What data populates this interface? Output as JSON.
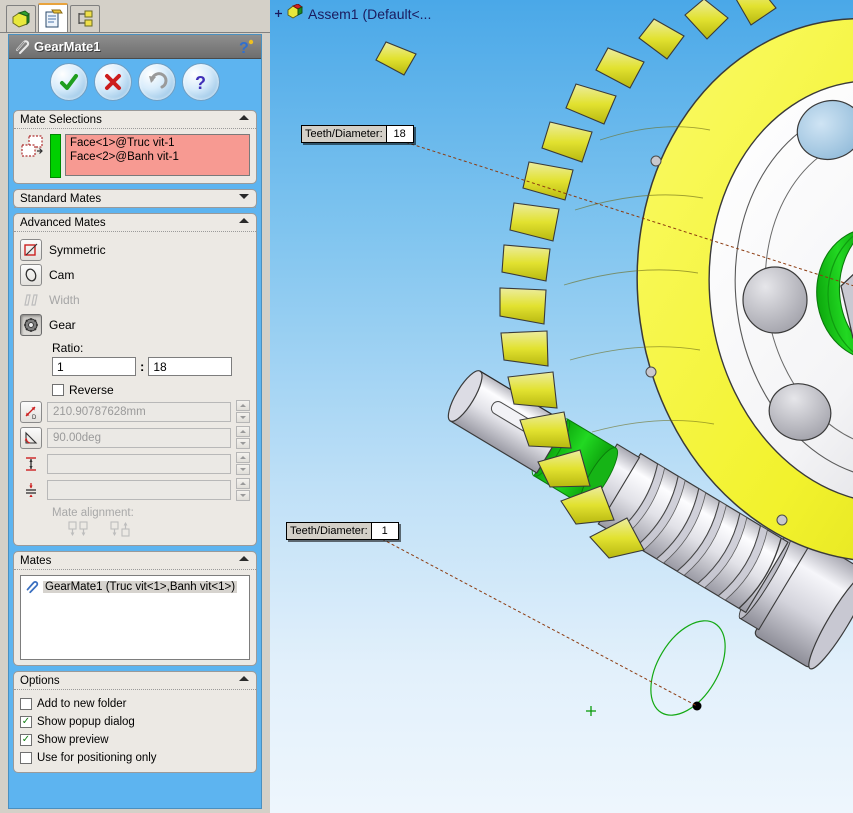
{
  "tabstrip": {
    "tabs": [
      {
        "name": "feature-manager-tab",
        "icon": "feature-tree-icon",
        "active": false
      },
      {
        "name": "property-manager-tab",
        "icon": "property-manager-icon",
        "active": true
      },
      {
        "name": "configuration-manager-tab",
        "icon": "configuration-manager-icon",
        "active": false
      }
    ]
  },
  "property_manager": {
    "title": "GearMate1",
    "title_icon": "mate-paperclip-icon",
    "help_icon": "help-question-icon",
    "actions": [
      {
        "label": "OK",
        "icon": "green-check-icon",
        "enabled": true
      },
      {
        "label": "Cancel",
        "icon": "red-x-icon",
        "enabled": true
      },
      {
        "label": "Undo",
        "icon": "undo-arrow-icon",
        "enabled": false
      },
      {
        "label": "Help",
        "icon": "blue-question-icon",
        "enabled": true
      }
    ]
  },
  "mate_selections": {
    "header": "Mate Selections",
    "expanded": true,
    "selection_icon": "entities-to-mate-icon",
    "entities": "Face<1>@Truc vit-1\nFace<2>@Banh vit-1",
    "entity_list": [
      "Face<1>@Truc vit-1",
      "Face<2>@Banh vit-1"
    ]
  },
  "standard_mates": {
    "header": "Standard Mates",
    "expanded": false
  },
  "advanced_mates": {
    "header": "Advanced Mates",
    "expanded": true,
    "items": [
      {
        "label": "Symmetric",
        "icon": "symmetric-mate-icon",
        "enabled": true,
        "selected": false
      },
      {
        "label": "Cam",
        "icon": "cam-mate-icon",
        "enabled": true,
        "selected": false
      },
      {
        "label": "Width",
        "icon": "width-mate-icon",
        "enabled": false,
        "selected": false
      },
      {
        "label": "Gear",
        "icon": "gear-mate-icon",
        "enabled": true,
        "selected": true
      }
    ],
    "ratio_label": "Ratio:",
    "ratio_first": "1",
    "ratio_separator": ":",
    "ratio_second": "18",
    "reverse_label": "Reverse",
    "reverse_checked": false,
    "fields": [
      {
        "icon": "distance-dimension-icon",
        "value": "210.90787628mm",
        "enabled": false
      },
      {
        "icon": "angle-dimension-icon",
        "value": "90.00deg",
        "enabled": false
      },
      {
        "icon": "max-distance-icon",
        "value": "",
        "enabled": false
      },
      {
        "icon": "min-distance-icon",
        "value": "",
        "enabled": false
      }
    ],
    "mate_alignment_label": "Mate alignment:",
    "alignment_options": [
      {
        "name": "aligned-icon",
        "enabled": false
      },
      {
        "name": "anti-aligned-icon",
        "enabled": false
      }
    ]
  },
  "mates": {
    "header": "Mates",
    "expanded": true,
    "items": [
      {
        "icon": "mate-paperclip-icon",
        "label": "GearMate1 (Truc vit<1>,Banh vit<1>)"
      }
    ]
  },
  "options": {
    "header": "Options",
    "expanded": true,
    "items": [
      {
        "label": "Add to new folder",
        "checked": false
      },
      {
        "label": "Show popup dialog",
        "checked": true
      },
      {
        "label": "Show preview",
        "checked": true
      },
      {
        "label": "Use for positioning only",
        "checked": false
      }
    ]
  },
  "viewport": {
    "assembly_title": "Assem1  (Default<...",
    "assembly_icon": "assembly-icon",
    "expand_icon": "plus-icon",
    "callouts": [
      {
        "label": "Teeth/Diameter:",
        "value": "18",
        "target": "worm-gear-wheel"
      },
      {
        "label": "Teeth/Diameter:",
        "value": "1",
        "target": "worm-shaft"
      }
    ]
  },
  "colors": {
    "gear_yellow": "#f2f22d",
    "selected_green": "#12c012",
    "hole_blue": "#a7cfea",
    "metal_gray": "#d9d9de",
    "panel_blue": "#5db4f0",
    "selection_pink": "#f79a92",
    "leader_line": "#8c3b10",
    "background_top": "#4aa8e8",
    "background_bottom": "#eef6fd"
  }
}
